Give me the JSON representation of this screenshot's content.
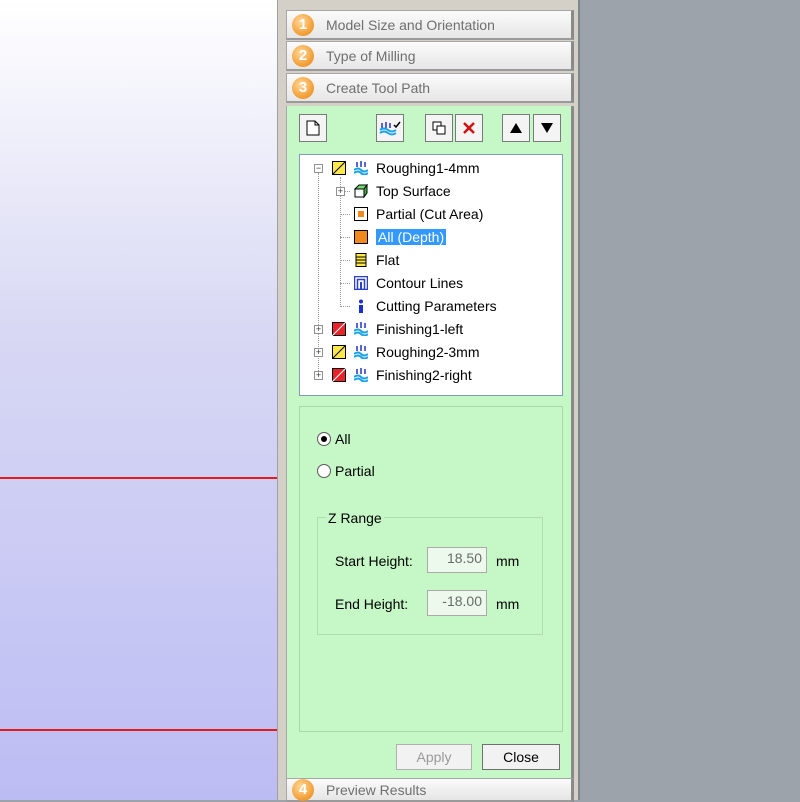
{
  "wizard": {
    "steps": [
      {
        "num": "1",
        "label": "Model Size and Orientation"
      },
      {
        "num": "2",
        "label": "Type of Milling"
      },
      {
        "num": "3",
        "label": "Create Tool Path"
      },
      {
        "num": "4",
        "label": "Preview Results"
      }
    ]
  },
  "toolbar": {
    "icons": [
      "new-document-icon",
      "apply-toolpath-icon",
      "copy-icon",
      "delete-icon",
      "move-up-icon",
      "move-down-icon"
    ]
  },
  "tree": {
    "root": "Roughing1-4mm",
    "children": [
      "Top Surface",
      "Partial (Cut Area)",
      "All (Depth)",
      "Flat",
      "Contour Lines",
      "Cutting Parameters"
    ],
    "siblings": [
      "Finishing1-left",
      "Roughing2-3mm",
      "Finishing2-right"
    ],
    "selected": "All (Depth)"
  },
  "depth": {
    "all_label": "All",
    "partial_label": "Partial",
    "selected": "All",
    "zrange_title": "Z Range",
    "start_label": "Start Height:",
    "start_value": "18.50",
    "end_label": "End Height:",
    "end_value": "-18.00",
    "unit": "mm"
  },
  "buttons": {
    "apply": "Apply",
    "close": "Close"
  },
  "colors": {
    "selection": "#3399ff",
    "panel_bg": "#c6f7c6",
    "step_badge": "#f29a2e",
    "red_line": "#e41b1b"
  }
}
